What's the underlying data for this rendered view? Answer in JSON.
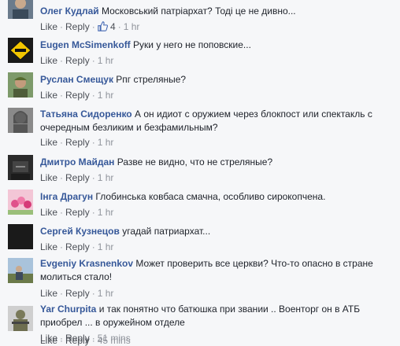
{
  "comments": [
    {
      "author": "Олег Кудлай",
      "text": "Московський патріархат? Тоді це не дивно...",
      "like": "Like",
      "reply": "Reply",
      "likes": "4",
      "time": "1 hr"
    },
    {
      "author": "Eugen McSimenkoff",
      "text": "Руки у него не поповские...",
      "like": "Like",
      "reply": "Reply",
      "time": "1 hr"
    },
    {
      "author": "Руслан Смещук",
      "text": "Рпг стреляные?",
      "like": "Like",
      "reply": "Reply",
      "time": "1 hr"
    },
    {
      "author": "Татьяна Сидоренко",
      "text_line1": "А он идиот с оружием через блокпост или спектакль с",
      "text_line2": "очередным безликим и безфамильным?",
      "like": "Like",
      "reply": "Reply",
      "time": "1 hr"
    },
    {
      "author": "Дмитро Майдан",
      "text": "Разве не видно, что не стреляные?",
      "like": "Like",
      "reply": "Reply",
      "time": "1 hr"
    },
    {
      "author": "Інга Драгун",
      "text": "Глобинська ковбаса смачна, особливо сирокопчена.",
      "like": "Like",
      "reply": "Reply",
      "time": "1 hr"
    },
    {
      "author": "Сергей Кузнецов",
      "text": "угадай патриархат...",
      "like": "Like",
      "reply": "Reply",
      "time": "1 hr"
    },
    {
      "author": "Evgeniy Krasnenkov",
      "text_line1": "Может проверить все церкви? Что-то опасно в стране",
      "text_line2": "молиться стало!",
      "like": "Like",
      "reply": "Reply",
      "time": "1 hr"
    },
    {
      "author": "Yar Churpita",
      "text_line1": "и так понятно что батюшка при звании .. Военторг он в АТБ",
      "text_line2": "приобрел ... в оружейном отделе",
      "like": "Like",
      "reply": "Reply",
      "time": "51 mins"
    },
    {
      "author": "",
      "text": "",
      "like": "Like",
      "reply": "Reply",
      "time": "45 mins"
    }
  ],
  "colors": {
    "link": "#365899",
    "meta": "#90949c",
    "text": "#1d2129",
    "background": "#f6f7f9"
  }
}
